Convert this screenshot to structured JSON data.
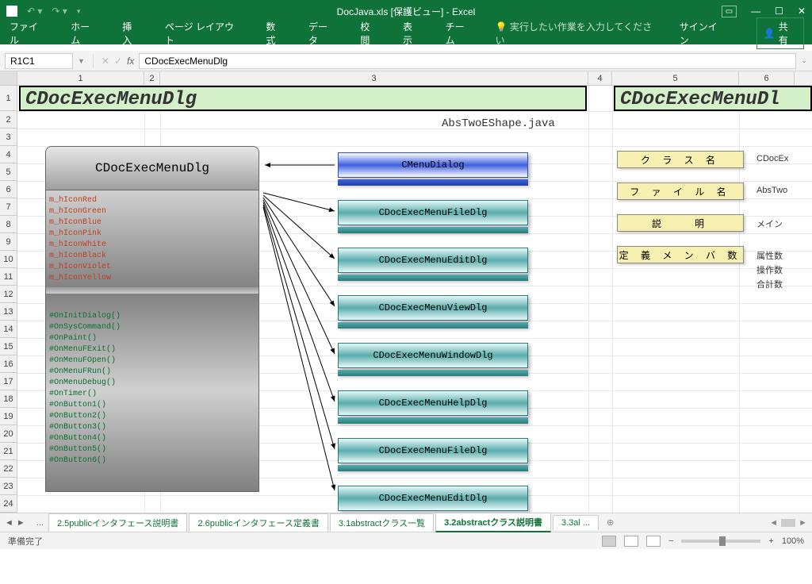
{
  "titlebar": {
    "title": "DocJava.xls [保護ビュー] - Excel"
  },
  "ribbon": {
    "tabs": [
      "ファイル",
      "ホーム",
      "挿入",
      "ページ レイアウト",
      "数式",
      "データ",
      "校閲",
      "表示",
      "チーム"
    ],
    "tell": "実行したい作業を入力してください",
    "signin": "サインイン",
    "share": "共有"
  },
  "formula": {
    "name": "R1C1",
    "value": "CDocExecMenuDlg"
  },
  "cols": [
    "1",
    "2",
    "3",
    "4",
    "5",
    "6"
  ],
  "rows": [
    "1",
    "2",
    "3",
    "4",
    "5",
    "6",
    "7",
    "8",
    "9",
    "10",
    "11",
    "12",
    "13",
    "14",
    "15",
    "16",
    "17",
    "18",
    "19",
    "20",
    "21",
    "22",
    "23",
    "24"
  ],
  "cells": {
    "title1": "CDocExecMenuDlg",
    "title2": "CDocExecMenuDl",
    "filename": "AbsTwoEShape.java"
  },
  "class": {
    "name": "CDocExecMenuDlg",
    "members": [
      "m_hIconRed",
      "m_hIconGreen",
      "m_hIconBlue",
      "m_hIconPink",
      "m_hIconWhite",
      "m_hIconBlack",
      "m_hIconViolet",
      "m_hIconYellow"
    ],
    "methods": [
      "#OnInitDialog()",
      "#OnSysCommand()",
      "#OnPaint()",
      "#OnMenuFExit()",
      "#OnMenuFOpen()",
      "#OnMenuFRun()",
      "#OnMenuDebug()",
      "#OnTimer()",
      "#OnButton1()",
      "#OnButton2()",
      "#OnButton3()",
      "#OnButton4()",
      "#OnButton5()",
      "#OnButton6()"
    ]
  },
  "related": [
    "CMenuDialog",
    "CDocExecMenuFileDlg",
    "CDocExecMenuEditDlg",
    "CDocExecMenuViewDlg",
    "CDocExecMenuWindowDlg",
    "CDocExecMenuHelpDlg",
    "CDocExecMenuFileDlg",
    "CDocExecMenuEditDlg"
  ],
  "labels": {
    "classname": "ク ラ ス 名",
    "filename": "フ ァ イ ル 名",
    "desc": "説　　明",
    "members": "定 義 メ ン バ 数"
  },
  "rvals": {
    "classname": "CDocEx",
    "filename": "AbsTwo",
    "desc": "メイン",
    "attr": "属性数",
    "op": "操作数",
    "total": "合計数"
  },
  "tabs": {
    "t1": "2.5publicインタフェース説明書",
    "t2": "2.6publicインタフェース定義書",
    "t3": "3.1abstractクラス一覧",
    "t4": "3.2abstractクラス説明書",
    "t5": "3.3al"
  },
  "status": {
    "ready": "準備完了",
    "zoom": "100%"
  }
}
